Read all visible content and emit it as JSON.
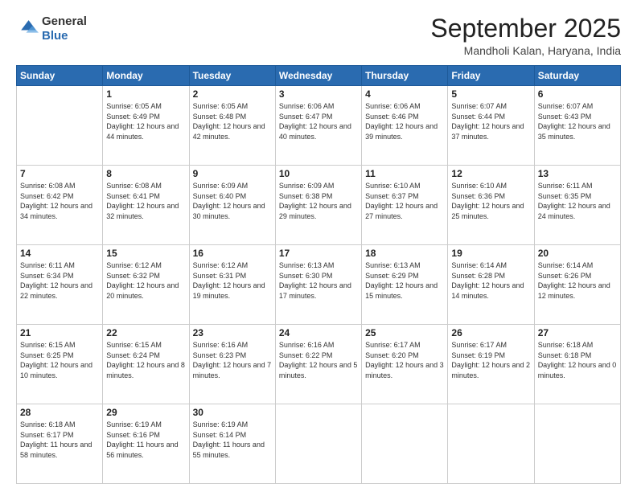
{
  "header": {
    "logo": {
      "general": "General",
      "blue": "Blue"
    },
    "title": "September 2025",
    "location": "Mandholi Kalan, Haryana, India"
  },
  "days_of_week": [
    "Sunday",
    "Monday",
    "Tuesday",
    "Wednesday",
    "Thursday",
    "Friday",
    "Saturday"
  ],
  "weeks": [
    [
      {
        "day": "",
        "sunrise": "",
        "sunset": "",
        "daylight": ""
      },
      {
        "day": "1",
        "sunrise": "Sunrise: 6:05 AM",
        "sunset": "Sunset: 6:49 PM",
        "daylight": "Daylight: 12 hours and 44 minutes."
      },
      {
        "day": "2",
        "sunrise": "Sunrise: 6:05 AM",
        "sunset": "Sunset: 6:48 PM",
        "daylight": "Daylight: 12 hours and 42 minutes."
      },
      {
        "day": "3",
        "sunrise": "Sunrise: 6:06 AM",
        "sunset": "Sunset: 6:47 PM",
        "daylight": "Daylight: 12 hours and 40 minutes."
      },
      {
        "day": "4",
        "sunrise": "Sunrise: 6:06 AM",
        "sunset": "Sunset: 6:46 PM",
        "daylight": "Daylight: 12 hours and 39 minutes."
      },
      {
        "day": "5",
        "sunrise": "Sunrise: 6:07 AM",
        "sunset": "Sunset: 6:44 PM",
        "daylight": "Daylight: 12 hours and 37 minutes."
      },
      {
        "day": "6",
        "sunrise": "Sunrise: 6:07 AM",
        "sunset": "Sunset: 6:43 PM",
        "daylight": "Daylight: 12 hours and 35 minutes."
      }
    ],
    [
      {
        "day": "7",
        "sunrise": "Sunrise: 6:08 AM",
        "sunset": "Sunset: 6:42 PM",
        "daylight": "Daylight: 12 hours and 34 minutes."
      },
      {
        "day": "8",
        "sunrise": "Sunrise: 6:08 AM",
        "sunset": "Sunset: 6:41 PM",
        "daylight": "Daylight: 12 hours and 32 minutes."
      },
      {
        "day": "9",
        "sunrise": "Sunrise: 6:09 AM",
        "sunset": "Sunset: 6:40 PM",
        "daylight": "Daylight: 12 hours and 30 minutes."
      },
      {
        "day": "10",
        "sunrise": "Sunrise: 6:09 AM",
        "sunset": "Sunset: 6:38 PM",
        "daylight": "Daylight: 12 hours and 29 minutes."
      },
      {
        "day": "11",
        "sunrise": "Sunrise: 6:10 AM",
        "sunset": "Sunset: 6:37 PM",
        "daylight": "Daylight: 12 hours and 27 minutes."
      },
      {
        "day": "12",
        "sunrise": "Sunrise: 6:10 AM",
        "sunset": "Sunset: 6:36 PM",
        "daylight": "Daylight: 12 hours and 25 minutes."
      },
      {
        "day": "13",
        "sunrise": "Sunrise: 6:11 AM",
        "sunset": "Sunset: 6:35 PM",
        "daylight": "Daylight: 12 hours and 24 minutes."
      }
    ],
    [
      {
        "day": "14",
        "sunrise": "Sunrise: 6:11 AM",
        "sunset": "Sunset: 6:34 PM",
        "daylight": "Daylight: 12 hours and 22 minutes."
      },
      {
        "day": "15",
        "sunrise": "Sunrise: 6:12 AM",
        "sunset": "Sunset: 6:32 PM",
        "daylight": "Daylight: 12 hours and 20 minutes."
      },
      {
        "day": "16",
        "sunrise": "Sunrise: 6:12 AM",
        "sunset": "Sunset: 6:31 PM",
        "daylight": "Daylight: 12 hours and 19 minutes."
      },
      {
        "day": "17",
        "sunrise": "Sunrise: 6:13 AM",
        "sunset": "Sunset: 6:30 PM",
        "daylight": "Daylight: 12 hours and 17 minutes."
      },
      {
        "day": "18",
        "sunrise": "Sunrise: 6:13 AM",
        "sunset": "Sunset: 6:29 PM",
        "daylight": "Daylight: 12 hours and 15 minutes."
      },
      {
        "day": "19",
        "sunrise": "Sunrise: 6:14 AM",
        "sunset": "Sunset: 6:28 PM",
        "daylight": "Daylight: 12 hours and 14 minutes."
      },
      {
        "day": "20",
        "sunrise": "Sunrise: 6:14 AM",
        "sunset": "Sunset: 6:26 PM",
        "daylight": "Daylight: 12 hours and 12 minutes."
      }
    ],
    [
      {
        "day": "21",
        "sunrise": "Sunrise: 6:15 AM",
        "sunset": "Sunset: 6:25 PM",
        "daylight": "Daylight: 12 hours and 10 minutes."
      },
      {
        "day": "22",
        "sunrise": "Sunrise: 6:15 AM",
        "sunset": "Sunset: 6:24 PM",
        "daylight": "Daylight: 12 hours and 8 minutes."
      },
      {
        "day": "23",
        "sunrise": "Sunrise: 6:16 AM",
        "sunset": "Sunset: 6:23 PM",
        "daylight": "Daylight: 12 hours and 7 minutes."
      },
      {
        "day": "24",
        "sunrise": "Sunrise: 6:16 AM",
        "sunset": "Sunset: 6:22 PM",
        "daylight": "Daylight: 12 hours and 5 minutes."
      },
      {
        "day": "25",
        "sunrise": "Sunrise: 6:17 AM",
        "sunset": "Sunset: 6:20 PM",
        "daylight": "Daylight: 12 hours and 3 minutes."
      },
      {
        "day": "26",
        "sunrise": "Sunrise: 6:17 AM",
        "sunset": "Sunset: 6:19 PM",
        "daylight": "Daylight: 12 hours and 2 minutes."
      },
      {
        "day": "27",
        "sunrise": "Sunrise: 6:18 AM",
        "sunset": "Sunset: 6:18 PM",
        "daylight": "Daylight: 12 hours and 0 minutes."
      }
    ],
    [
      {
        "day": "28",
        "sunrise": "Sunrise: 6:18 AM",
        "sunset": "Sunset: 6:17 PM",
        "daylight": "Daylight: 11 hours and 58 minutes."
      },
      {
        "day": "29",
        "sunrise": "Sunrise: 6:19 AM",
        "sunset": "Sunset: 6:16 PM",
        "daylight": "Daylight: 11 hours and 56 minutes."
      },
      {
        "day": "30",
        "sunrise": "Sunrise: 6:19 AM",
        "sunset": "Sunset: 6:14 PM",
        "daylight": "Daylight: 11 hours and 55 minutes."
      },
      {
        "day": "",
        "sunrise": "",
        "sunset": "",
        "daylight": ""
      },
      {
        "day": "",
        "sunrise": "",
        "sunset": "",
        "daylight": ""
      },
      {
        "day": "",
        "sunrise": "",
        "sunset": "",
        "daylight": ""
      },
      {
        "day": "",
        "sunrise": "",
        "sunset": "",
        "daylight": ""
      }
    ]
  ]
}
